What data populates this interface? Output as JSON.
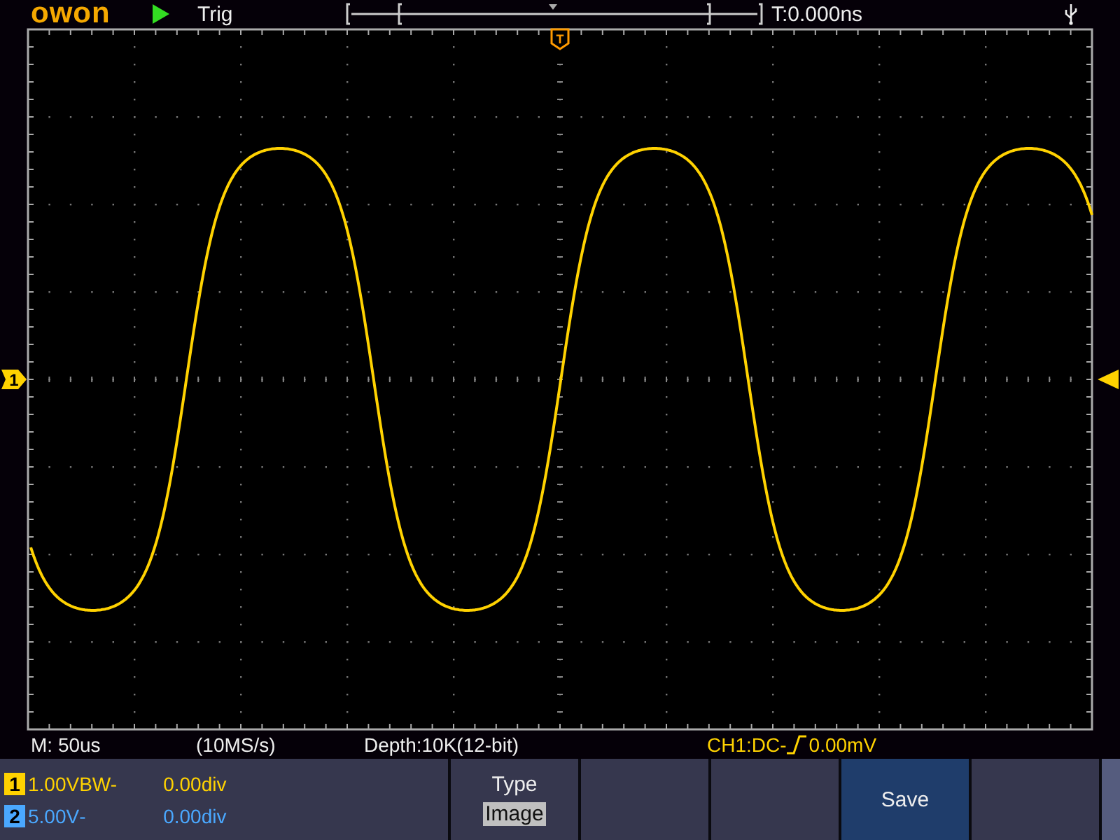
{
  "header": {
    "logo": "owon",
    "trigger_state": "Trig",
    "time_offset": "T:0.000ns"
  },
  "markers": {
    "trigger_time": "T",
    "channel": "1"
  },
  "status_line": {
    "timebase": "M: 50us",
    "sample_rate": "(10MS/s)",
    "depth": "Depth:10K(12-bit)",
    "trigger_source": "CH1:DC-",
    "trigger_level": "0.00mV"
  },
  "channels": [
    {
      "number": "1",
      "scale": "1.00V",
      "coupling": "BW-",
      "offset": "0.00div",
      "color": "#ffd200"
    },
    {
      "number": "2",
      "scale": "5.00V",
      "coupling": "-",
      "offset": "0.00div",
      "color": "#4aa8ff"
    }
  ],
  "menu": [
    {
      "label": "Type",
      "value": "Image",
      "selected": false
    },
    {
      "selected": false
    },
    {
      "selected": false
    },
    {
      "label": "Save",
      "selected": true
    },
    {
      "selected": false
    }
  ]
}
